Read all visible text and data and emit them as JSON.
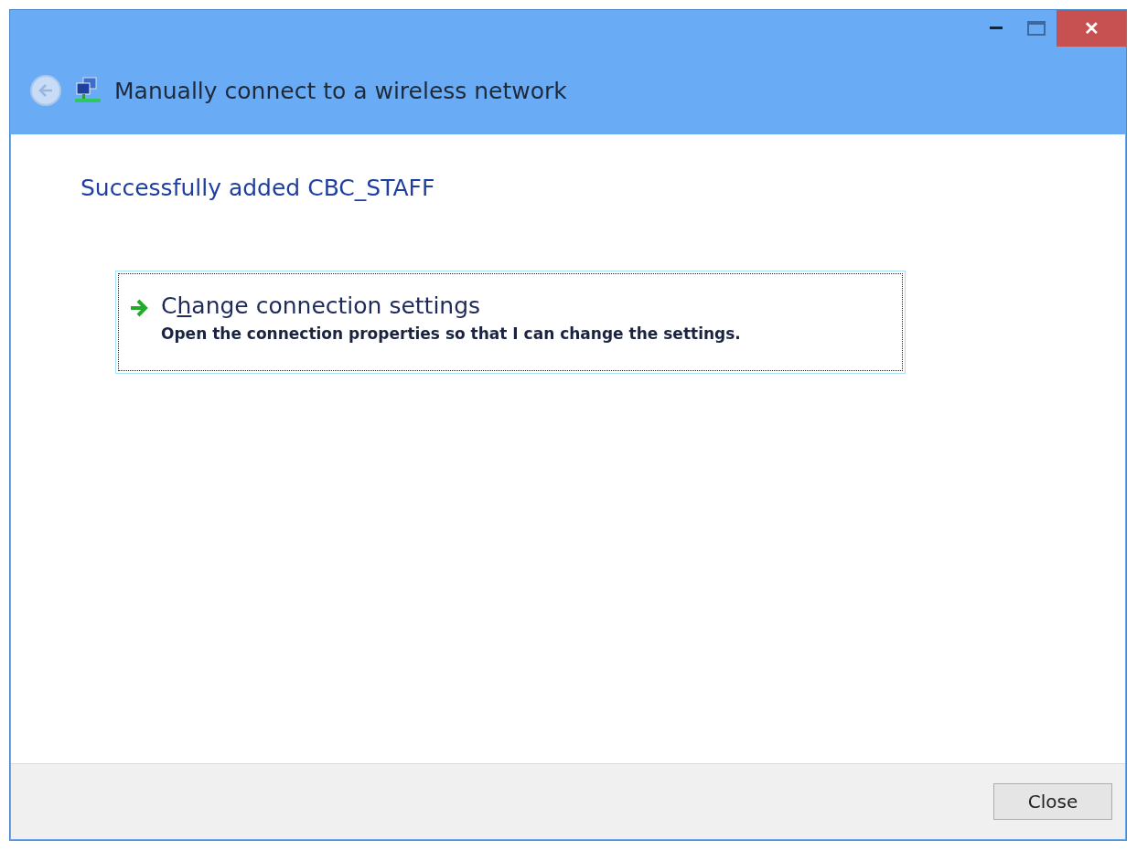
{
  "window": {
    "title": "Manually connect to a wireless network",
    "close": "✕"
  },
  "heading": "Successfully added CBC_STAFF",
  "options": [
    {
      "label_before": "C",
      "access_key": "h",
      "label_after": "ange connection settings",
      "description": "Open the connection properties so that I can change the settings."
    }
  ],
  "buttons": [
    "Close"
  ]
}
